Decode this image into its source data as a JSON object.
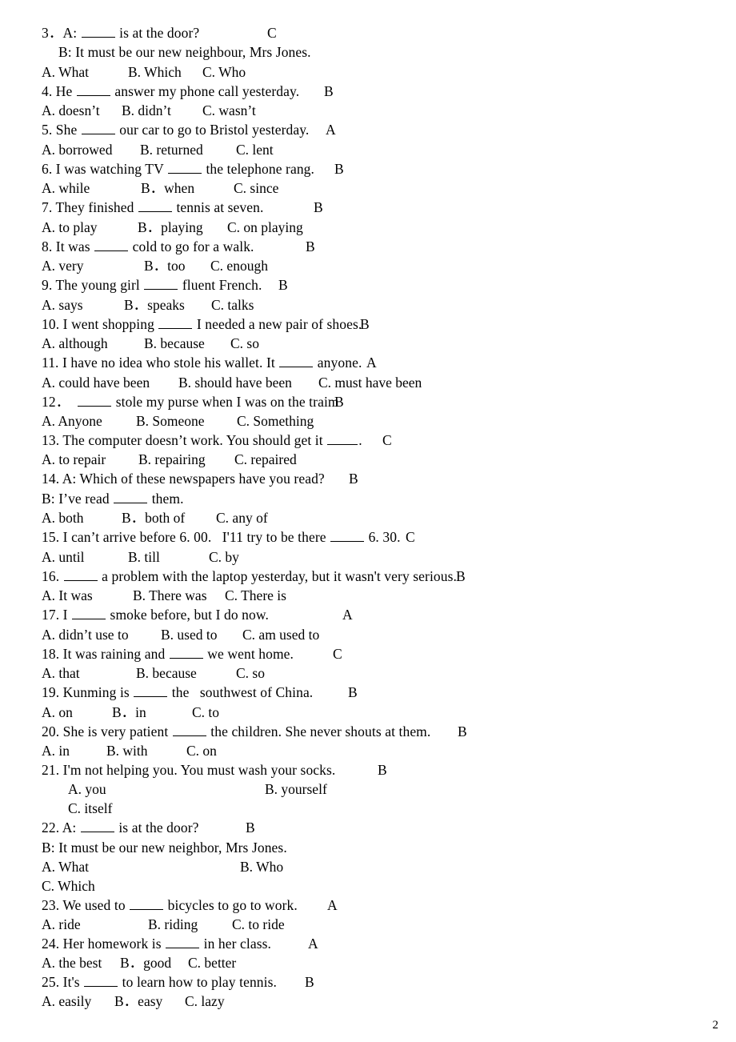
{
  "document": {
    "type": "multiple-choice-grammar-worksheet",
    "page_number": "2",
    "text_color": "#000000",
    "background_color": "#ffffff"
  },
  "questions": [
    {
      "number": "3．",
      "stem_before": "A: ",
      "stem_after": " is at the door?",
      "has_blank": true,
      "extra_line": "B: It must be our new neighbour, Mrs Jones.",
      "answer": "C",
      "options": [
        {
          "label": "A. What"
        },
        {
          "label": "B. Which"
        },
        {
          "label": "C. Who"
        }
      ]
    },
    {
      "number": "4.",
      "stem_before": " He ",
      "stem_after": " answer my phone call yesterday.",
      "has_blank": true,
      "answer": "B",
      "options": [
        {
          "label": "A. doesn’t"
        },
        {
          "label": "B. didn’t"
        },
        {
          "label": "C. wasn’t"
        }
      ]
    },
    {
      "number": "5.",
      "stem_before": " She ",
      "stem_after": " our car to go to Bristol yesterday.",
      "has_blank": true,
      "answer": "A",
      "options": [
        {
          "label": "A. borrowed"
        },
        {
          "label": "B. returned"
        },
        {
          "label": "C. lent"
        }
      ]
    },
    {
      "number": "6.",
      "stem_before": " I was watching TV ",
      "stem_after": " the telephone rang.",
      "has_blank": true,
      "answer": "B",
      "options": [
        {
          "label": "A. while"
        },
        {
          "label": "B．when"
        },
        {
          "label": "C. since"
        }
      ]
    },
    {
      "number": "7.",
      "stem_before": " They finished ",
      "stem_after": " tennis at seven.",
      "has_blank": true,
      "answer": "B",
      "options": [
        {
          "label": "A. to play"
        },
        {
          "label": "B．playing"
        },
        {
          "label": "C. on playing"
        }
      ]
    },
    {
      "number": "8.",
      "stem_before": " It was ",
      "stem_after": " cold to go for a walk.",
      "has_blank": true,
      "answer": "B",
      "options": [
        {
          "label": "A. very"
        },
        {
          "label": "B．too"
        },
        {
          "label": "C. enough"
        }
      ]
    },
    {
      "number": "9.",
      "stem_before": " The young girl ",
      "stem_after": " fluent French.",
      "has_blank": true,
      "answer": "B",
      "options": [
        {
          "label": "A. says"
        },
        {
          "label": "B．speaks"
        },
        {
          "label": "C. talks"
        }
      ]
    },
    {
      "number": "10.",
      "stem_before": " I went shopping ",
      "stem_after": " I needed a new pair of shoes.",
      "has_blank": true,
      "answer": "B",
      "options": [
        {
          "label": "A. although"
        },
        {
          "label": "B. because"
        },
        {
          "label": "C. so"
        }
      ]
    },
    {
      "number": "11.",
      "stem_before": " I have no idea who stole his wallet. It ",
      "stem_after": " anyone.",
      "has_blank": true,
      "answer": "A",
      "options": [
        {
          "label": "A. could have been"
        },
        {
          "label": "B. should have been"
        },
        {
          "label": "C. must have been"
        }
      ]
    },
    {
      "number": "12．",
      "stem_before": "  ",
      "stem_after": " stole my purse when I was on the traim",
      "has_blank": true,
      "answer": "B",
      "options": [
        {
          "label": "A. Anyone"
        },
        {
          "label": "B. Someone"
        },
        {
          "label": "C. Something"
        }
      ]
    },
    {
      "number": "13.",
      "stem_before": " The computer doesn’t work. You should get it ",
      "stem_after": ".",
      "has_blank": true,
      "answer": "C",
      "options": [
        {
          "label": "A. to repair"
        },
        {
          "label": "B. repairing"
        },
        {
          "label": "C. repaired"
        }
      ]
    },
    {
      "number": "14.",
      "stem_before": " A: Which of these newspapers have you read?",
      "stem_after": "",
      "has_blank": false,
      "extra_line_before": "B: I’ve read ",
      "extra_line_after": " them.",
      "extra_line_has_blank": true,
      "answer": "B",
      "options": [
        {
          "label": "A. both"
        },
        {
          "label": "B．both of"
        },
        {
          "label": "C. any of"
        }
      ]
    },
    {
      "number": "15.",
      "stem_before": " I can’t arrive before 6. 00.   I'11 try to be there ",
      "stem_after": " 6. 30.",
      "has_blank": true,
      "answer": "C",
      "options": [
        {
          "label": "A. until"
        },
        {
          "label": "B. till"
        },
        {
          "label": "C. by"
        }
      ]
    },
    {
      "number": "16.",
      "stem_before": " ",
      "stem_after": " a problem with the laptop yesterday, but it wasn't very serious.",
      "has_blank": true,
      "answer": "B",
      "options": [
        {
          "label": "A. It was"
        },
        {
          "label": "B. There was"
        },
        {
          "label": "C. There is"
        }
      ]
    },
    {
      "number": "17.",
      "stem_before": " I ",
      "stem_after": " smoke before, but I do now.",
      "has_blank": true,
      "answer": "A",
      "options": [
        {
          "label": "A. didn’t use to"
        },
        {
          "label": "B. used to"
        },
        {
          "label": "C. am used to"
        }
      ]
    },
    {
      "number": "18.",
      "stem_before": " It was raining and ",
      "stem_after": " we went home.",
      "has_blank": true,
      "answer": "C",
      "options": [
        {
          "label": "A. that"
        },
        {
          "label": "B. because"
        },
        {
          "label": "C. so"
        }
      ]
    },
    {
      "number": "19.",
      "stem_before": " Kunming is ",
      "stem_after": " the   southwest of China.",
      "has_blank": true,
      "answer": "B",
      "options": [
        {
          "label": "A. on"
        },
        {
          "label": "B．in"
        },
        {
          "label": "C. to"
        }
      ]
    },
    {
      "number": "20.",
      "stem_before": " She is very patient ",
      "stem_after": " the children. She never shouts at them.",
      "has_blank": true,
      "answer": "B",
      "options": [
        {
          "label": "A. in"
        },
        {
          "label": "B. with"
        },
        {
          "label": "C. on"
        }
      ]
    },
    {
      "number": "21.",
      "stem_before": " I'm not helping you. You must wash your socks.",
      "stem_after": "",
      "has_blank": false,
      "answer": "B",
      "options": [
        {
          "label": "A. you"
        },
        {
          "label": "B. yourself"
        },
        {
          "label": "C. itself"
        }
      ]
    },
    {
      "number": "22.",
      "stem_before": " A: ",
      "stem_after": " is at the door?",
      "has_blank": true,
      "extra_line": "B: It must be our new neighbor, Mrs Jones.",
      "answer": "B",
      "options": [
        {
          "label": "A. What"
        },
        {
          "label": "B. Who"
        },
        {
          "label": "C. Which"
        }
      ]
    },
    {
      "number": "23.",
      "stem_before": " We used to ",
      "stem_after": " bicycles to go to work.",
      "has_blank": true,
      "answer": "A",
      "options": [
        {
          "label": "A. ride"
        },
        {
          "label": "B. riding"
        },
        {
          "label": "C. to ride"
        }
      ]
    },
    {
      "number": "24.",
      "stem_before": " Her homework is ",
      "stem_after": " in her class.",
      "has_blank": true,
      "answer": "A",
      "options": [
        {
          "label": "A. the best"
        },
        {
          "label": "B．good"
        },
        {
          "label": "C. better"
        }
      ]
    },
    {
      "number": "25.",
      "stem_before": " It's ",
      "stem_after": " to learn how to play tennis.",
      "has_blank": true,
      "answer": "B",
      "options": [
        {
          "label": "A. easily"
        },
        {
          "label": "B．easy"
        },
        {
          "label": "C. lazy"
        }
      ]
    }
  ]
}
